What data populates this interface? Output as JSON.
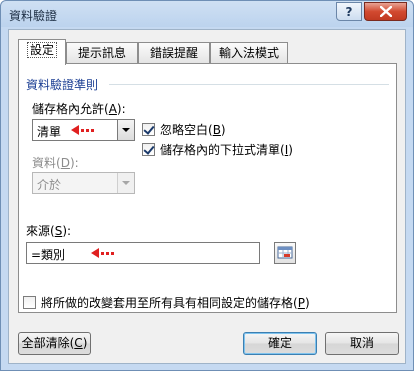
{
  "window": {
    "title": "資料驗證",
    "help_label": "?"
  },
  "tabs": [
    {
      "label": "設定",
      "active": true
    },
    {
      "label": "提示訊息",
      "active": false
    },
    {
      "label": "錯誤提醒",
      "active": false
    },
    {
      "label": "輸入法模式",
      "active": false
    }
  ],
  "criteria": {
    "group_title": "資料驗證準則",
    "allow_label": "儲存格內允許(",
    "allow_key": "A",
    "allow_suffix": "):",
    "allow_value": "清單",
    "data_label": "資料(",
    "data_key": "D",
    "data_suffix": "):",
    "data_value": "介於",
    "source_label": "來源(",
    "source_key": "S",
    "source_suffix": "):",
    "source_value": "=類別",
    "ignore_blank_label": "忽略空白(",
    "ignore_blank_key": "B",
    "ignore_blank_suffix": ")",
    "ignore_blank_checked": true,
    "dropdown_label": "儲存格內的下拉式清單(",
    "dropdown_key": "I",
    "dropdown_suffix": ")",
    "dropdown_checked": true
  },
  "apply_all": {
    "label": "將所做的改變套用至所有具有相同設定的儲存格(",
    "key": "P",
    "suffix": ")",
    "checked": false
  },
  "buttons": {
    "clear_label": "全部清除(",
    "clear_key": "C",
    "clear_suffix": ")",
    "ok_label": "確定",
    "cancel_label": "取消"
  },
  "colors": {
    "annotation_arrow": "#e02020",
    "group_title": "#1c3f94"
  },
  "icons": {
    "close": "close-icon",
    "range_select": "range-select-icon",
    "annotation": "red-arrow-icon"
  }
}
